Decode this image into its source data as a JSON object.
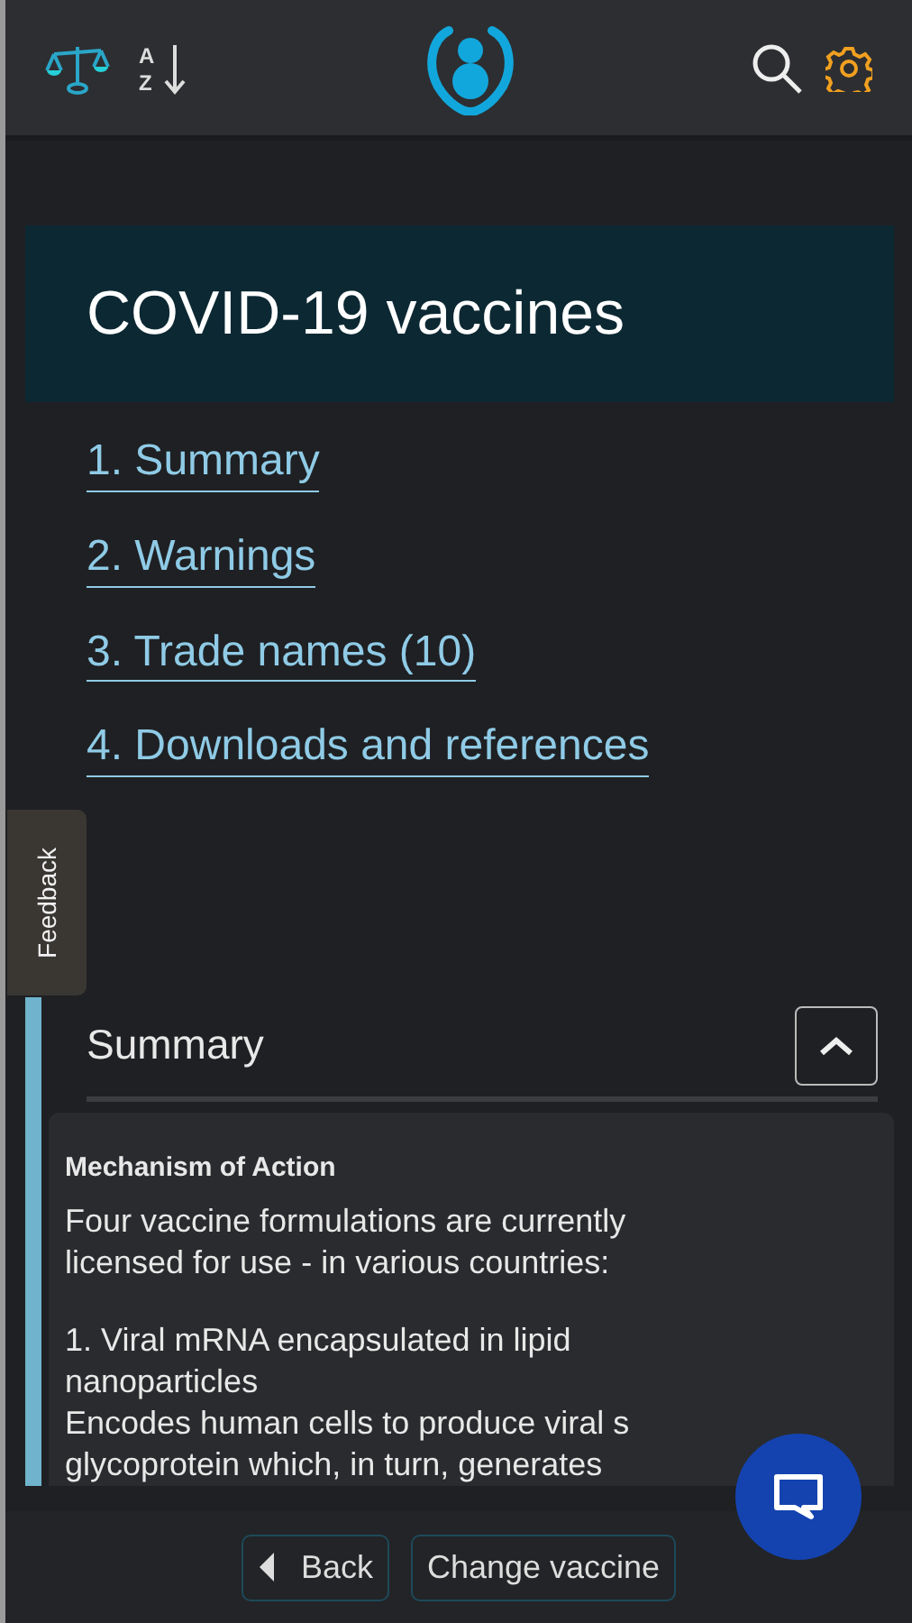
{
  "header": {
    "sort_letters": [
      "A",
      "Z"
    ]
  },
  "title": "COVID-19 vaccines",
  "links": [
    {
      "label": "1. Summary"
    },
    {
      "label": "2. Warnings"
    },
    {
      "label": "3. Trade names (10)"
    },
    {
      "label": "4. Downloads and references"
    }
  ],
  "feedback_tab": "Feedback",
  "section": {
    "title": "Summary",
    "expanded": true,
    "card": {
      "heading": "Mechanism of Action",
      "paragraphs": [
        [
          "Four vaccine formulations are currently",
          "licensed for use - in various countries:"
        ],
        [
          "1. Viral mRNA encapsulated in lipid",
          "nanoparticles",
          "Encodes human cells to produce viral s",
          "glycoprotein which, in turn, generates"
        ]
      ]
    }
  },
  "footer": {
    "buttons": [
      {
        "label": "Back",
        "kind": "back"
      },
      {
        "label": "Change vaccine",
        "kind": "plain"
      }
    ]
  }
}
